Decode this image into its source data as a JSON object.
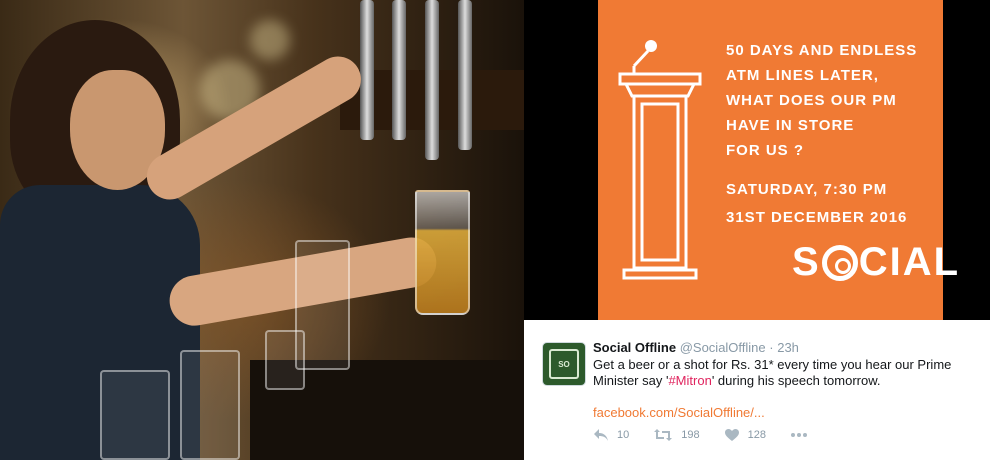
{
  "poster": {
    "headline_lines": [
      "50 DAYS AND ENDLESS",
      "ATM LINES LATER,",
      "WHAT DOES OUR PM",
      "HAVE IN STORE",
      "FOR US ?"
    ],
    "when_lines": [
      "SATURDAY, 7:30 PM",
      "31ST DECEMBER 2016"
    ],
    "brand_left": "S",
    "brand_right": "CIAL",
    "background_color": "#f07a34",
    "icon": "podium-microphone-icon"
  },
  "tweet": {
    "name": "Social Offline",
    "handle": "@SocialOffline",
    "time": "· 23h",
    "text_before": "Get a beer or a shot for Rs. 31* every time you hear our Prime Minister say '",
    "hashtag": "#Mitron",
    "text_after": "' during his speech tomorrow.",
    "link": "facebook.com/SocialOffline/...",
    "actions": {
      "reply_count": "10",
      "retweet_count": "198",
      "like_count": "128"
    },
    "colors": {
      "link": "#f07a34",
      "hashtag": "#e0245e",
      "muted": "#8899a6"
    }
  }
}
